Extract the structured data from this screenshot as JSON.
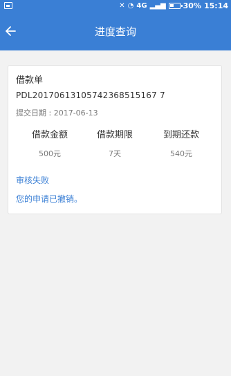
{
  "status_bar": {
    "network": "4G",
    "battery": "30%",
    "time": "15:14"
  },
  "app_bar": {
    "title": "进度查询"
  },
  "card": {
    "title": "借款单",
    "order_number": "PDL20170613105742368515167 7",
    "submit_date": "提交日期 : 2017-06-13",
    "stats": [
      {
        "label": "借款金额",
        "value": "500元"
      },
      {
        "label": "借款期限",
        "value": "7天"
      },
      {
        "label": "到期还款",
        "value": "540元"
      }
    ],
    "status": "审核失败",
    "message": "您的申请已撤销。"
  },
  "colors": {
    "accent": "#3a7fd5",
    "background": "#f2f2f2"
  },
  "icons": {
    "back": "arrow-left-icon"
  }
}
